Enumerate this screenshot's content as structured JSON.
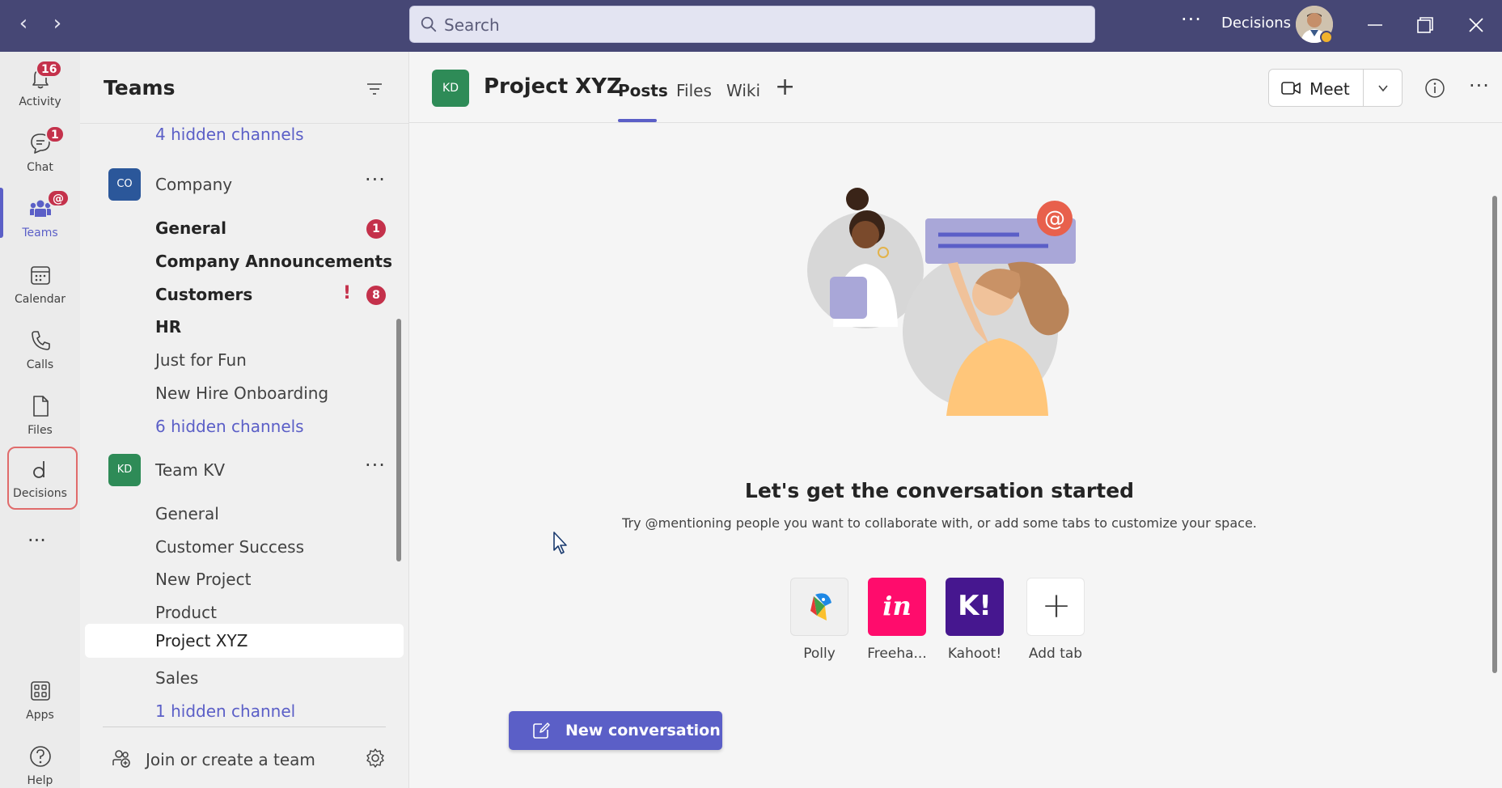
{
  "titlebar": {
    "search_placeholder": "Search",
    "more": "···",
    "org_name": "Decisions"
  },
  "appbar": {
    "items": [
      {
        "label": "Activity",
        "badge": "16",
        "icon": "bell-icon"
      },
      {
        "label": "Chat",
        "badge": "1",
        "icon": "chat-icon"
      },
      {
        "label": "Teams",
        "badge": "@",
        "icon": "teams-icon"
      },
      {
        "label": "Calendar",
        "icon": "calendar-icon"
      },
      {
        "label": "Calls",
        "icon": "phone-icon"
      },
      {
        "label": "Files",
        "icon": "file-icon"
      },
      {
        "label": "Decisions",
        "icon": "decisions-app-icon"
      },
      {
        "label": "Apps",
        "icon": "apps-grid-icon"
      },
      {
        "label": "Help",
        "icon": "help-icon"
      }
    ],
    "more": "···"
  },
  "teams_panel": {
    "title": "Teams",
    "top_hidden": "4 hidden channels",
    "teams": [
      {
        "name": "Company",
        "initials": "CO",
        "color": "#2b579a",
        "more": "···",
        "channels": [
          {
            "name": "General",
            "badge": "1"
          },
          {
            "name": "Company Announcements"
          },
          {
            "name": "Customers",
            "important": "!",
            "badge": "8"
          },
          {
            "name": "HR"
          },
          {
            "name": "Just for Fun"
          },
          {
            "name": "New Hire Onboarding"
          },
          {
            "name": "6 hidden channels"
          }
        ]
      },
      {
        "name": "Team KV",
        "initials": "KD",
        "color": "#2e8b57",
        "more": "···",
        "channels": [
          {
            "name": "General"
          },
          {
            "name": "Customer Success"
          },
          {
            "name": "New Project"
          },
          {
            "name": "Product"
          },
          {
            "name": "Project XYZ"
          },
          {
            "name": "Sales"
          },
          {
            "name": "1 hidden channel"
          }
        ]
      }
    ],
    "join_label": "Join or create a team"
  },
  "main": {
    "channel_initials": "KD",
    "channel_title": "Project XYZ",
    "tabs": [
      {
        "label": "Posts"
      },
      {
        "label": "Files"
      },
      {
        "label": "Wiki"
      }
    ],
    "add_tab": "+",
    "meet_label": "Meet",
    "more": "···",
    "empty_title": "Let's get the conversation started",
    "empty_subtitle": "Try @mentioning people you want to collaborate with, or add some tabs to customize your space.",
    "apps": [
      {
        "name": "Polly"
      },
      {
        "name": "Freeha...",
        "glyph": "in"
      },
      {
        "name": "Kahoot!",
        "glyph": "K!"
      },
      {
        "name": "Add tab",
        "glyph": "+"
      }
    ],
    "new_conversation": "New conversation"
  },
  "colors": {
    "titlebar": "#464775",
    "accent": "#5b5fc7",
    "badge": "#c4314b"
  }
}
